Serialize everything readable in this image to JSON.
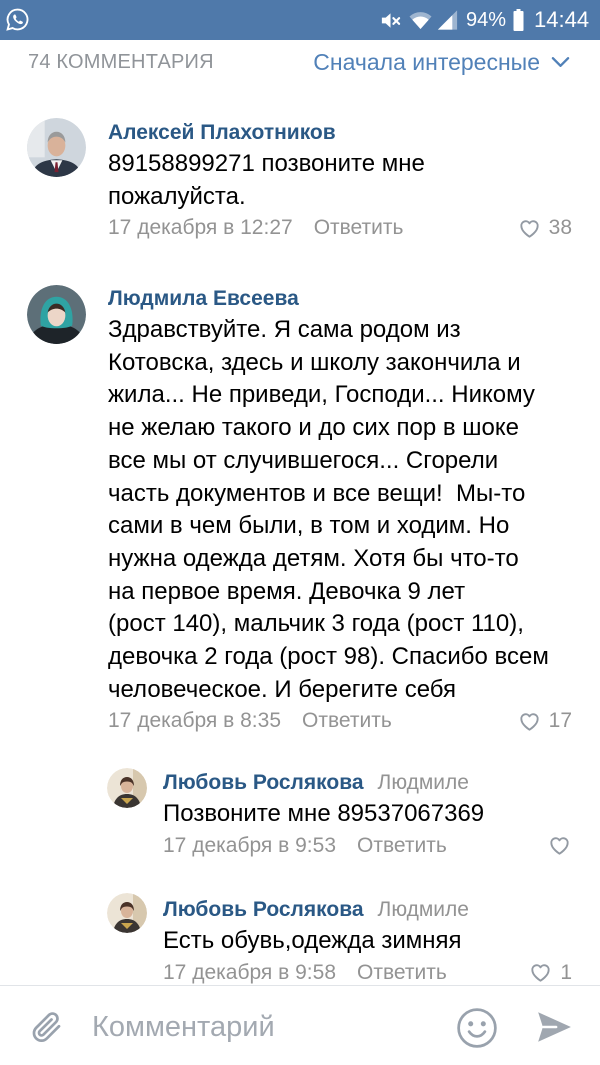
{
  "status_bar": {
    "notification_icons": [
      "whatsapp-icon"
    ],
    "system_icons": [
      "mute-icon",
      "wifi-icon",
      "signal-icon",
      "battery-icon"
    ],
    "battery_percent": "94%",
    "time": "14:44"
  },
  "comments_header": {
    "count_label": "74 КОММЕНТАРИЯ",
    "sort_label": "Сначала интересные",
    "sort_icon": "chevron-down-icon"
  },
  "comments": [
    {
      "author": "Алексей Плахотников",
      "text": "89158899271 позвоните мне\nпожалуйста.",
      "date": "17 декабря в 12:27",
      "reply_label": "Ответить",
      "like_icon": "heart-icon",
      "likes": "38"
    },
    {
      "author": "Людмила Евсеева",
      "text": "Здравствуйте. Я сама родом из\nКотовска, здесь и школу закончила и\nжила... Не приведи, Господи... Никому\nне желаю такого и до сих пор в шоке\nвсе мы от случившегося... Сгорели\nчасть документов и все вещи!  Мы-то\nсами в чем были, в том и ходим. Но\nнужна одежда детям. Хотя бы что-то\nна первое время. Девочка 9 лет\n(рост 140), мальчик 3 года (рост 110),\nдевочка 2 года (рост 98). Спасибо всем\nчеловеческое. И берегите себя",
      "date": "17 декабря в 8:35",
      "reply_label": "Ответить",
      "like_icon": "heart-icon",
      "likes": "17",
      "replies": [
        {
          "author": "Любовь Рослякова",
          "reply_to": "Людмиле",
          "text": "Позвоните мне 89537067369",
          "date": "17 декабря в 9:53",
          "reply_label": "Ответить",
          "like_icon": "heart-icon"
        },
        {
          "author": "Любовь Рослякова",
          "reply_to": "Людмиле",
          "text": "Есть обувь,одежда зимняя",
          "date": "17 декабря в 9:58",
          "reply_label": "Ответить",
          "like_icon": "heart-icon",
          "likes": "1"
        }
      ]
    }
  ],
  "composer": {
    "attach_icon": "paperclip-icon",
    "placeholder": "Комментарий",
    "emoji_icon": "smile-icon",
    "send_icon": "send-icon"
  },
  "colors": {
    "status_bar": "#4f79aa",
    "accent": "#5181b8",
    "author_name": "#2a5885",
    "secondary_text": "#939393",
    "icon_gray": "#99a2ad"
  }
}
